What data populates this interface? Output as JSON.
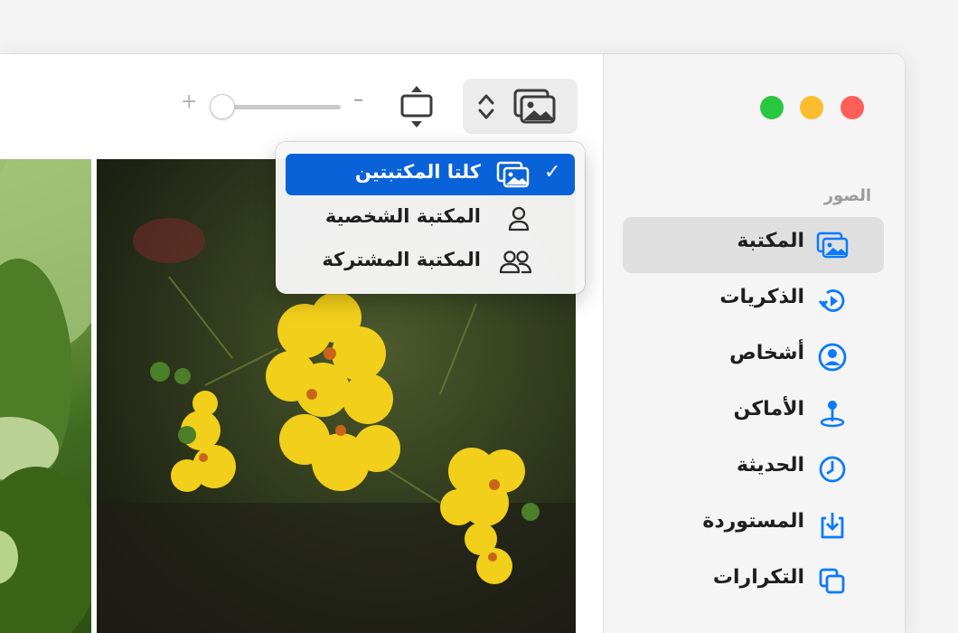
{
  "window": {
    "traffic_lights": [
      "close",
      "minimize",
      "zoom"
    ],
    "colors": {
      "close": "#fe5f57",
      "minimize": "#fdbc2f",
      "zoom": "#29c740"
    }
  },
  "toolbar": {
    "zoom_in_label": "+",
    "zoom_out_label": "–",
    "zoom_level": 0.05,
    "fit_icon": "aspect-fit-icon",
    "library_switcher_icon": "photo-library-icon"
  },
  "library_menu": {
    "items": [
      {
        "label": "كلتا المكتبتين",
        "icon": "both-libraries-icon",
        "checked": true
      },
      {
        "label": "المكتبة الشخصية",
        "icon": "person-icon",
        "checked": false
      },
      {
        "label": "المكتبة المشتركة",
        "icon": "people-icon",
        "checked": false
      }
    ],
    "check_mark": "✓",
    "selected_color": "#0a62d8"
  },
  "sidebar": {
    "section_title": "الصور",
    "items": [
      {
        "label": "المكتبة",
        "icon": "library-icon",
        "selected": true
      },
      {
        "label": "الذكريات",
        "icon": "memories-icon",
        "selected": false
      },
      {
        "label": "أشخاص",
        "icon": "people-circle-icon",
        "selected": false
      },
      {
        "label": "الأماكن",
        "icon": "places-pin-icon",
        "selected": false
      },
      {
        "label": "الحديثة",
        "icon": "clock-icon",
        "selected": false
      },
      {
        "label": "المستوردة",
        "icon": "import-icon",
        "selected": false
      },
      {
        "label": "التكرارات",
        "icon": "duplicates-icon",
        "selected": false
      }
    ],
    "accent_color": "#0a7aff"
  }
}
